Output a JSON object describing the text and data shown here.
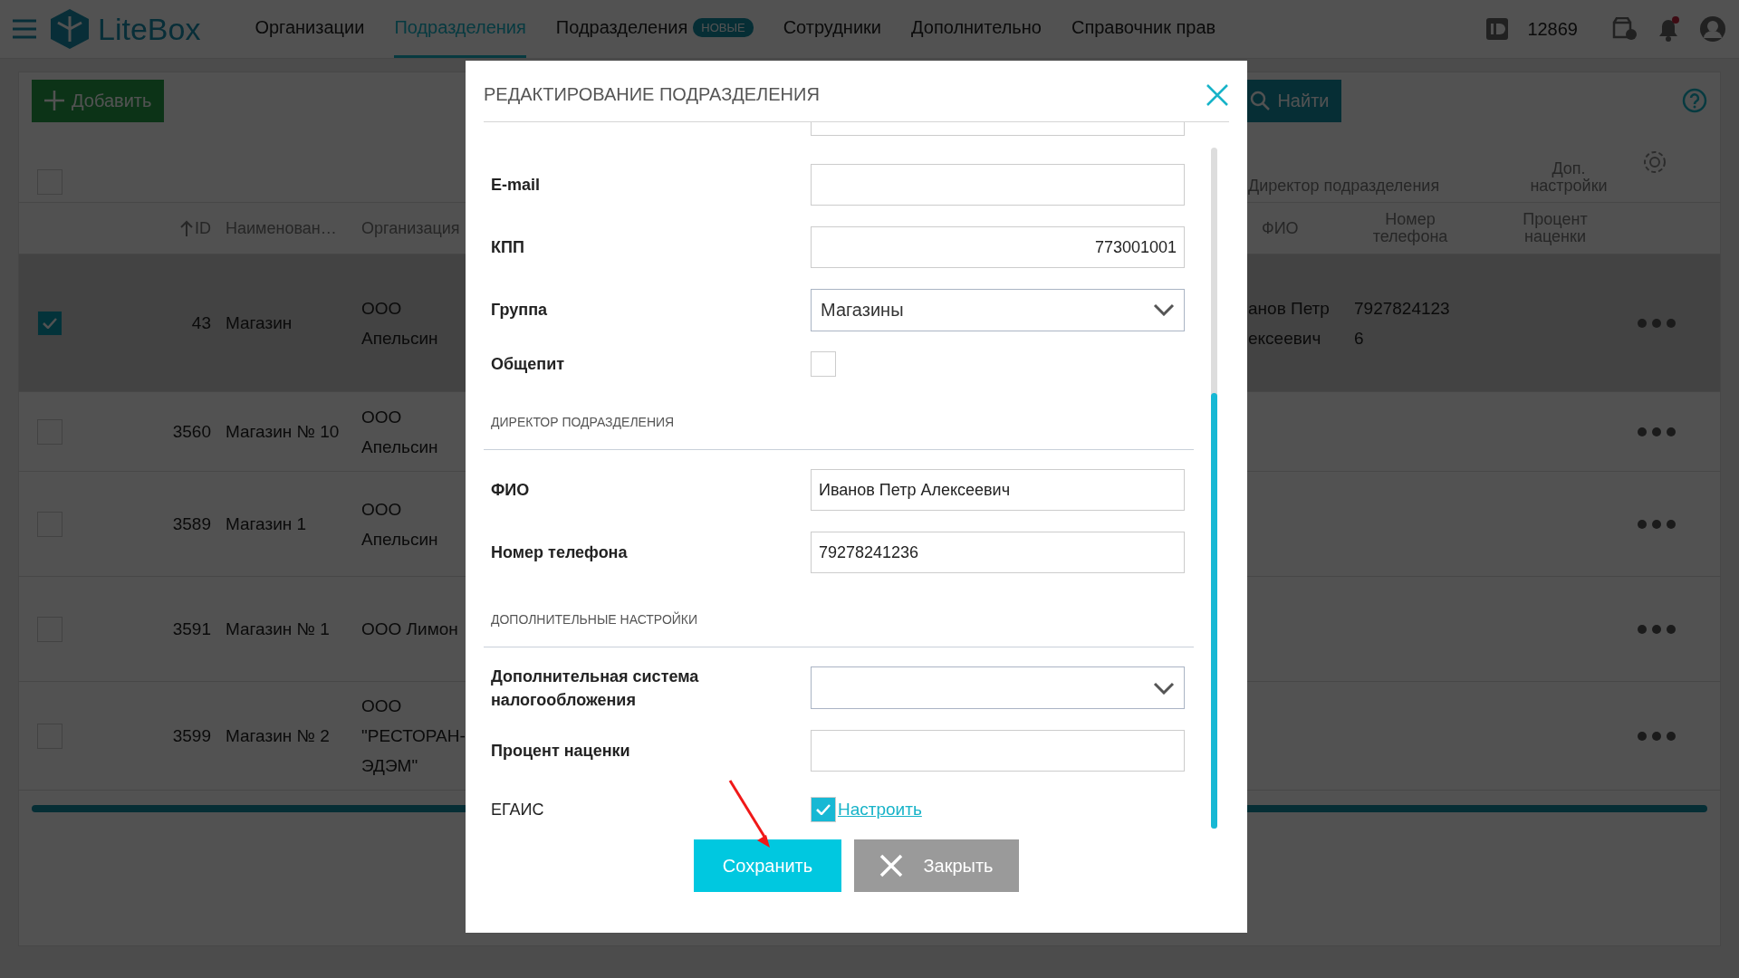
{
  "header": {
    "logo": "LiteBox",
    "nav": [
      {
        "label": "Организации",
        "selected": false
      },
      {
        "label": "Подразделения",
        "selected": true
      },
      {
        "label": "Подразделения",
        "selected": false,
        "badge": "НОВЫЕ"
      },
      {
        "label": "Сотрудники",
        "selected": false
      },
      {
        "label": "Дополнительно",
        "selected": false
      },
      {
        "label": "Справочник прав",
        "selected": false
      }
    ],
    "account_id": "12869"
  },
  "toolbar": {
    "add_button": "Добавить",
    "search_button": "Найти"
  },
  "select_all_checked": false,
  "table": {
    "group_headers": [
      "Директор подразделения",
      "Доп. настройки"
    ],
    "columns": [
      "ID",
      "Наименован…",
      "Организация",
      "ФИО",
      "Номер телефона",
      "Процент наценки"
    ],
    "rows": [
      {
        "checked": true,
        "selected": true,
        "id": "43",
        "name": "Магазин",
        "organization": "ООО Апельсин",
        "director_name": "анов Петр ексеевич",
        "director_phone": "79278241236"
      },
      {
        "checked": false,
        "selected": false,
        "id": "3560",
        "name": "Магазин № 10",
        "organization": "ООО Апельсин"
      },
      {
        "checked": false,
        "selected": false,
        "id": "3589",
        "name": "Магазин 1",
        "organization": "ООО Апельсин"
      },
      {
        "checked": false,
        "selected": false,
        "id": "3591",
        "name": "Магазин № 1",
        "organization": "ООО Лимон"
      },
      {
        "checked": false,
        "selected": false,
        "id": "3599",
        "name": "Магазин № 2",
        "organization": "ООО \"РЕСТОРАН-ЭДЭМ\""
      }
    ]
  },
  "dialog": {
    "title": "РЕДАКТИРОВАНИЕ ПОДРАЗДЕЛЕНИЯ",
    "fields": [
      {
        "kind": "input",
        "label": "E-mail"
      },
      {
        "kind": "number",
        "label": "КПП",
        "value": "773001001"
      },
      {
        "kind": "select",
        "label": "Группа",
        "value": "Магазины"
      },
      {
        "kind": "checkbox",
        "label": "Общепит",
        "checked": false
      },
      {
        "kind": "section",
        "label": "ДИРЕКТОР ПОДРАЗДЕЛЕНИЯ"
      },
      {
        "kind": "input",
        "label": "ФИО",
        "value": "Иванов Петр Алексеевич"
      },
      {
        "kind": "input",
        "label": "Номер телефона",
        "value": "79278241236"
      },
      {
        "kind": "section",
        "label": "ДОПОЛНИТЕЛЬНЫЕ НАСТРОЙКИ"
      },
      {
        "kind": "select",
        "label": "Дополнительная система налогообложения"
      },
      {
        "kind": "input",
        "label": "Процент наценки"
      },
      {
        "kind": "checkbox",
        "label": "ЕГАИС",
        "checked": true,
        "link": "Настроить"
      }
    ],
    "save_button": "Сохранить",
    "close_button": "Закрыть"
  }
}
